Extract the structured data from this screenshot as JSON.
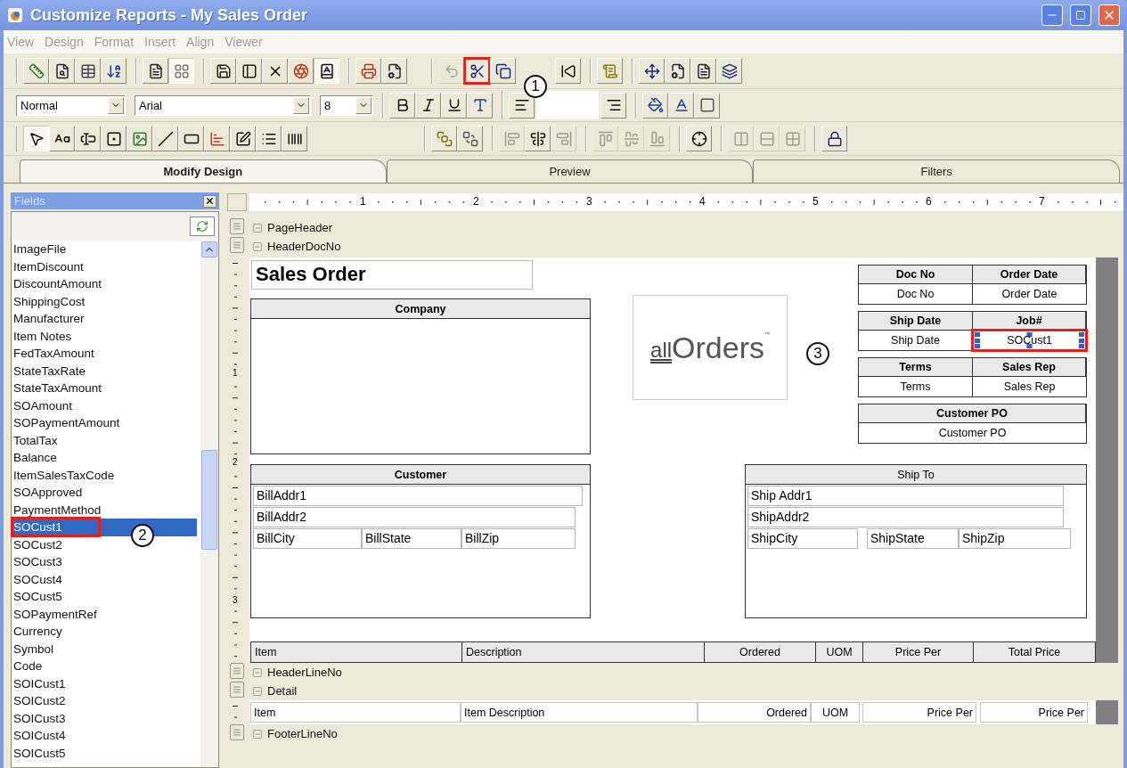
{
  "window": {
    "title": "Customize Reports - My Sales Order"
  },
  "menu": [
    "View",
    "Design",
    "Format",
    "Insert",
    "Align",
    "Viewer"
  ],
  "toolbar_main": {
    "left": [
      [
        {
          "kind": "design",
          "pressed": false,
          "disabled": false,
          "highlighted": false
        },
        {
          "kind": "preview",
          "pressed": false,
          "disabled": false,
          "highlighted": false
        },
        {
          "kind": "table",
          "pressed": false,
          "disabled": false,
          "highlighted": false
        },
        {
          "kind": "sort",
          "pressed": false,
          "disabled": false,
          "highlighted": false
        }
      ],
      [
        {
          "kind": "page",
          "pressed": false,
          "disabled": false,
          "highlighted": false
        },
        {
          "kind": "grid",
          "pressed": true,
          "disabled": false,
          "highlighted": false
        }
      ],
      [
        {
          "kind": "save",
          "pressed": false,
          "disabled": false,
          "highlighted": false
        },
        {
          "kind": "layout",
          "pressed": false,
          "disabled": false,
          "highlighted": false
        },
        {
          "kind": "delete",
          "pressed": false,
          "disabled": false,
          "highlighted": false
        },
        {
          "kind": "color",
          "pressed": false,
          "disabled": false,
          "highlighted": false
        },
        {
          "kind": "check",
          "pressed": true,
          "disabled": false,
          "highlighted": false
        }
      ],
      [
        {
          "kind": "print",
          "pressed": false,
          "disabled": false,
          "highlighted": false
        },
        {
          "kind": "properties",
          "pressed": false,
          "disabled": false,
          "highlighted": false
        }
      ]
    ],
    "right": [
      [
        {
          "kind": "undo",
          "pressed": false,
          "disabled": true,
          "highlighted": false
        },
        {
          "kind": "cut",
          "pressed": false,
          "disabled": false,
          "highlighted": true
        },
        {
          "kind": "copy",
          "pressed": false,
          "disabled": false,
          "highlighted": false
        },
        {
          "kind": "back",
          "pressed": false,
          "disabled": false,
          "highlighted": false
        }
      ],
      [
        {
          "kind": "script",
          "pressed": false,
          "disabled": false,
          "highlighted": false
        }
      ],
      [
        {
          "kind": "snap",
          "pressed": false,
          "disabled": false,
          "highlighted": false
        },
        {
          "kind": "properties",
          "pressed": false,
          "disabled": false,
          "highlighted": false
        },
        {
          "kind": "page",
          "pressed": false,
          "disabled": false,
          "highlighted": false
        },
        {
          "kind": "layers",
          "pressed": false,
          "disabled": false,
          "highlighted": false
        }
      ]
    ]
  },
  "toolbar_format": {
    "style": "Normal",
    "font": "Arial",
    "size": "8",
    "groups": [
      [
        {
          "kind": "bold",
          "pressed": false,
          "disabled": false,
          "highlighted": false
        },
        {
          "kind": "italic",
          "pressed": false,
          "disabled": false,
          "highlighted": false
        },
        {
          "kind": "underline",
          "pressed": false,
          "disabled": false,
          "highlighted": false
        },
        {
          "kind": "font",
          "pressed": false,
          "disabled": false,
          "highlighted": false
        }
      ],
      [
        {
          "kind": "align_left",
          "pressed": false,
          "disabled": false,
          "highlighted": false
        },
        {
          "kind": "align_right",
          "pressed": false,
          "disabled": false,
          "highlighted": false
        }
      ],
      [
        {
          "kind": "fill",
          "pressed": false,
          "disabled": false,
          "highlighted": false
        },
        {
          "kind": "font_color",
          "pressed": false,
          "disabled": false,
          "highlighted": false
        },
        {
          "kind": "border",
          "pressed": false,
          "disabled": false,
          "highlighted": false
        }
      ]
    ]
  },
  "toolbar_controls": {
    "left": [
      [
        {
          "kind": "pointer",
          "pressed": true,
          "disabled": false,
          "highlighted": false
        },
        {
          "kind": "label",
          "pressed": false,
          "disabled": false,
          "highlighted": false
        },
        {
          "kind": "textbox",
          "pressed": false,
          "disabled": false,
          "highlighted": false
        },
        {
          "kind": "checkbox",
          "pressed": false,
          "disabled": false,
          "highlighted": false
        },
        {
          "kind": "picture",
          "pressed": false,
          "disabled": false,
          "highlighted": false
        },
        {
          "kind": "line",
          "pressed": false,
          "disabled": false,
          "highlighted": false
        },
        {
          "kind": "rectangle",
          "pressed": false,
          "disabled": false,
          "highlighted": false
        },
        {
          "kind": "chart",
          "pressed": false,
          "disabled": false,
          "highlighted": false
        },
        {
          "kind": "subreport",
          "pressed": false,
          "disabled": false,
          "highlighted": false
        },
        {
          "kind": "list",
          "pressed": false,
          "disabled": false,
          "highlighted": false
        },
        {
          "kind": "barcode",
          "pressed": false,
          "disabled": false,
          "highlighted": false
        }
      ]
    ],
    "right": [
      [
        {
          "kind": "front",
          "pressed": false,
          "disabled": false,
          "highlighted": false
        },
        {
          "kind": "send_back",
          "pressed": false,
          "disabled": false,
          "highlighted": false
        }
      ],
      [
        {
          "kind": "align_l",
          "pressed": false,
          "disabled": true,
          "highlighted": false
        },
        {
          "kind": "align_c",
          "pressed": false,
          "disabled": false,
          "highlighted": false
        },
        {
          "kind": "align_r",
          "pressed": false,
          "disabled": true,
          "highlighted": false
        }
      ],
      [
        {
          "kind": "top",
          "pressed": false,
          "disabled": true,
          "highlighted": false
        },
        {
          "kind": "middle",
          "pressed": false,
          "disabled": true,
          "highlighted": false
        },
        {
          "kind": "bottom",
          "pressed": false,
          "disabled": true,
          "highlighted": false
        }
      ],
      [
        {
          "kind": "center",
          "pressed": false,
          "disabled": false,
          "highlighted": false
        }
      ],
      [
        {
          "kind": "same_width",
          "pressed": false,
          "disabled": true,
          "highlighted": false
        },
        {
          "kind": "same_height",
          "pressed": false,
          "disabled": true,
          "highlighted": false
        },
        {
          "kind": "same_size",
          "pressed": false,
          "disabled": true,
          "highlighted": false
        }
      ],
      [
        {
          "kind": "lock",
          "pressed": false,
          "disabled": false,
          "highlighted": false
        }
      ]
    ]
  },
  "tabs": [
    {
      "label": "Modify Design",
      "selected": true
    },
    {
      "label": "Preview",
      "selected": false
    },
    {
      "label": "Filters",
      "selected": false
    }
  ],
  "fields": {
    "title": "Fields",
    "items": [
      {
        "label": "ImageFile",
        "selected": false,
        "highlighted": false
      },
      {
        "label": "ItemDiscount",
        "selected": false,
        "highlighted": false
      },
      {
        "label": "DiscountAmount",
        "selected": false,
        "highlighted": false
      },
      {
        "label": "ShippingCost",
        "selected": false,
        "highlighted": false
      },
      {
        "label": "Manufacturer",
        "selected": false,
        "highlighted": false
      },
      {
        "label": "Item Notes",
        "selected": false,
        "highlighted": false
      },
      {
        "label": "FedTaxAmount",
        "selected": false,
        "highlighted": false
      },
      {
        "label": "StateTaxRate",
        "selected": false,
        "highlighted": false
      },
      {
        "label": "StateTaxAmount",
        "selected": false,
        "highlighted": false
      },
      {
        "label": "SOAmount",
        "selected": false,
        "highlighted": false
      },
      {
        "label": "SOPaymentAmount",
        "selected": false,
        "highlighted": false
      },
      {
        "label": "TotalTax",
        "selected": false,
        "highlighted": false
      },
      {
        "label": "Balance",
        "selected": false,
        "highlighted": false
      },
      {
        "label": "ItemSalesTaxCode",
        "selected": false,
        "highlighted": false
      },
      {
        "label": "SOApproved",
        "selected": false,
        "highlighted": false
      },
      {
        "label": "PaymentMethod",
        "selected": false,
        "highlighted": false
      },
      {
        "label": "SOCust1",
        "selected": true,
        "highlighted": true
      },
      {
        "label": "SOCust2",
        "selected": false,
        "highlighted": false
      },
      {
        "label": "SOCust3",
        "selected": false,
        "highlighted": false
      },
      {
        "label": "SOCust4",
        "selected": false,
        "highlighted": false
      },
      {
        "label": "SOCust5",
        "selected": false,
        "highlighted": false
      },
      {
        "label": "SOPaymentRef",
        "selected": false,
        "highlighted": false
      },
      {
        "label": "Currency",
        "selected": false,
        "highlighted": false
      },
      {
        "label": "Symbol",
        "selected": false,
        "highlighted": false
      },
      {
        "label": "Code",
        "selected": false,
        "highlighted": false
      },
      {
        "label": "SOICust1",
        "selected": false,
        "highlighted": false
      },
      {
        "label": "SOICust2",
        "selected": false,
        "highlighted": false
      },
      {
        "label": "SOICust3",
        "selected": false,
        "highlighted": false
      },
      {
        "label": "SOICust4",
        "selected": false,
        "highlighted": false
      },
      {
        "label": "SOICust5",
        "selected": false,
        "highlighted": false
      }
    ]
  },
  "ruler": [
    "1",
    "2",
    "3",
    "4",
    "5",
    "6",
    "7"
  ],
  "bands": [
    {
      "kind": "band",
      "name": "PageHeader",
      "expanded": true
    },
    {
      "kind": "band",
      "name": "HeaderDocNo",
      "expanded": true
    },
    {
      "kind": "header_doc",
      "side_marks": [
        "1",
        "2",
        "3"
      ],
      "title": "Sales Order",
      "company": "Company",
      "logo": {
        "prefix": "all",
        "name": "Orders",
        "mark": "™"
      },
      "info": [
        {
          "headers": [
            "Doc No",
            "Order Date"
          ],
          "values": [
            {
              "text": "Doc No",
              "highlighted": false
            },
            {
              "text": "Order Date",
              "highlighted": false
            }
          ]
        },
        {
          "headers": [
            "Ship Date",
            "Job#"
          ],
          "values": [
            {
              "text": "Ship Date",
              "highlighted": false
            },
            {
              "text": "SOCust1",
              "highlighted": true
            }
          ]
        },
        {
          "headers": [
            "Terms",
            "Sales Rep"
          ],
          "values": [
            {
              "text": "Terms",
              "highlighted": false
            },
            {
              "text": "Sales Rep",
              "highlighted": false
            }
          ]
        },
        {
          "headers": [
            "Customer PO"
          ],
          "values": [
            {
              "text": "Customer PO",
              "highlighted": false
            }
          ]
        }
      ],
      "customer": {
        "label": "Customer",
        "lines": [
          [
            "BillAddr1"
          ],
          [
            "BillAddr2"
          ],
          [
            "BillCity",
            "BillState",
            "BillZip"
          ]
        ]
      },
      "ship_to": {
        "label": "Ship To",
        "lines": [
          [
            "Ship Addr1"
          ],
          [
            "ShipAddr2"
          ],
          [
            "ShipCity",
            "ShipState",
            "ShipZip"
          ]
        ]
      },
      "columns": [
        "Item",
        "Description",
        "Ordered",
        "UOM",
        "Price Per",
        "Total Price"
      ]
    },
    {
      "kind": "band",
      "name": "HeaderLineNo",
      "expanded": true
    },
    {
      "kind": "band",
      "name": "Detail",
      "expanded": true
    },
    {
      "kind": "detail",
      "cells": [
        "Item",
        "Item Description",
        "Ordered",
        "UOM",
        "Price Per",
        "Price Per"
      ]
    },
    {
      "kind": "band",
      "name": "FooterLineNo",
      "expanded": true
    }
  ],
  "callouts": [
    "1",
    "2",
    "3"
  ]
}
